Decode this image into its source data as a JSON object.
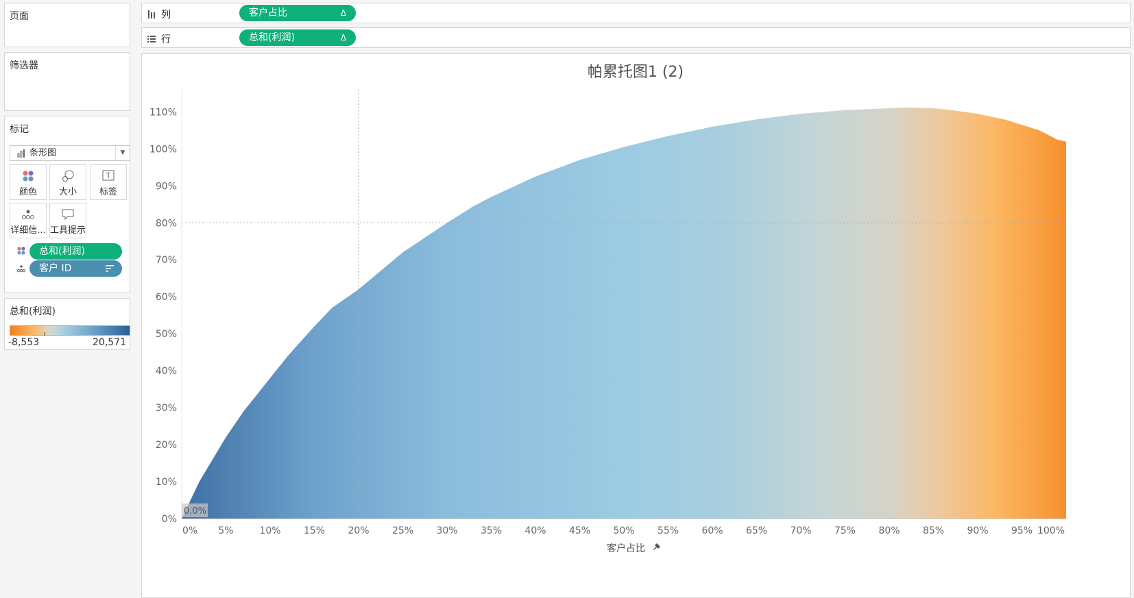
{
  "left_panels": {
    "pages": {
      "title": "页面"
    },
    "filters": {
      "title": "筛选器"
    },
    "marks": {
      "title": "标记",
      "mark_type": "条形图",
      "buttons": [
        {
          "label": "颜色",
          "icon": "color-icon"
        },
        {
          "label": "大小",
          "icon": "size-icon"
        },
        {
          "label": "标签",
          "icon": "label-icon"
        },
        {
          "label": "详细信...",
          "icon": "detail-icon"
        },
        {
          "label": "工具提示",
          "icon": "tooltip-icon"
        }
      ],
      "fields": [
        {
          "label": "总和(利润)",
          "icon": "color-icon",
          "color": "#10b07c"
        },
        {
          "label": "客户 ID",
          "icon": "detail-icon",
          "color": "#4a8fb0"
        }
      ]
    },
    "legend": {
      "title": "总和(利润)",
      "min_label": "-8,553",
      "max_label": "20,571"
    }
  },
  "shelves": {
    "columns": {
      "label": "列",
      "pill": "客户占比",
      "pill_marker": "Δ"
    },
    "rows": {
      "label": "行",
      "pill": "总和(利润)",
      "pill_marker": "Δ"
    }
  },
  "chart_data": {
    "type": "bar",
    "title": "帕累托图1 (2)",
    "xlabel": "客户占比",
    "ylabel": "",
    "x_ticks": [
      "0%",
      "5%",
      "10%",
      "15%",
      "20%",
      "25%",
      "30%",
      "35%",
      "40%",
      "45%",
      "50%",
      "55%",
      "60%",
      "65%",
      "70%",
      "75%",
      "80%",
      "85%",
      "90%",
      "95%",
      "100%"
    ],
    "y_ticks": [
      "0%",
      "10%",
      "20%",
      "30%",
      "40%",
      "50%",
      "60%",
      "70%",
      "80%",
      "90%",
      "100%",
      "110%"
    ],
    "xlim": [
      0,
      1
    ],
    "ylim": [
      0,
      1.16
    ],
    "reference_lines": {
      "x": 0.2,
      "y": 0.8
    },
    "annotation": "0.0%",
    "series": [
      {
        "x": [
          0,
          0.01,
          0.02,
          0.03,
          0.05,
          0.07,
          0.1,
          0.12,
          0.15,
          0.17,
          0.2,
          0.23,
          0.25,
          0.3,
          0.33,
          0.35,
          0.4,
          0.45,
          0.5,
          0.55,
          0.6,
          0.65,
          0.7,
          0.75,
          0.8,
          0.82,
          0.85,
          0.87,
          0.9,
          0.93,
          0.95,
          0.97,
          0.99,
          1.0
        ],
        "y": [
          0.0,
          0.05,
          0.1,
          0.14,
          0.22,
          0.29,
          0.38,
          0.44,
          0.52,
          0.57,
          0.62,
          0.68,
          0.72,
          0.8,
          0.845,
          0.87,
          0.925,
          0.97,
          1.005,
          1.035,
          1.06,
          1.08,
          1.095,
          1.105,
          1.11,
          1.112,
          1.11,
          1.105,
          1.095,
          1.08,
          1.065,
          1.05,
          1.025,
          1.02
        ]
      }
    ],
    "color_stops": [
      {
        "x": 0.0,
        "color": "#3f6fa3"
      },
      {
        "x": 0.15,
        "color": "#6ea2cc"
      },
      {
        "x": 0.3,
        "color": "#8bbcdc"
      },
      {
        "x": 0.5,
        "color": "#9ccbe2"
      },
      {
        "x": 0.62,
        "color": "#a9cfdf"
      },
      {
        "x": 0.72,
        "color": "#c4d5d6"
      },
      {
        "x": 0.8,
        "color": "#d6d3c8"
      },
      {
        "x": 0.86,
        "color": "#efc89a"
      },
      {
        "x": 0.92,
        "color": "#fbb763"
      },
      {
        "x": 1.0,
        "color": "#f7902e"
      }
    ],
    "grid": false
  }
}
